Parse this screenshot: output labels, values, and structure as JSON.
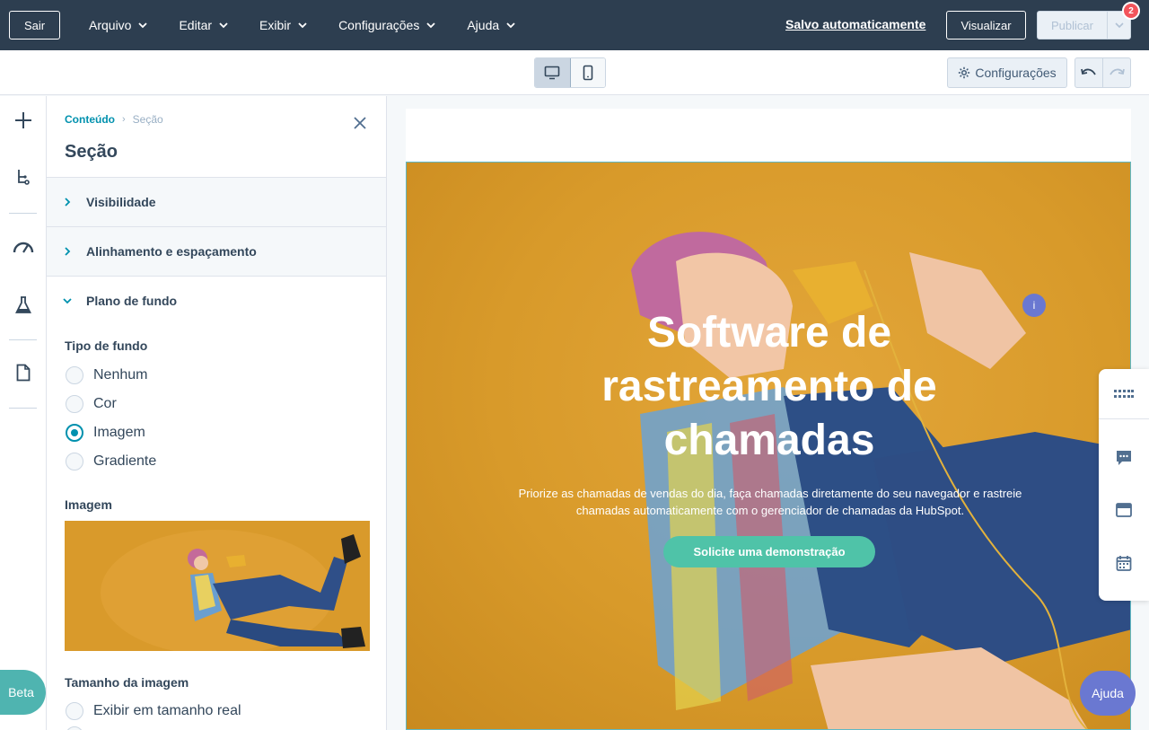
{
  "topbar": {
    "exit_label": "Sair",
    "menu": [
      {
        "label": "Arquivo"
      },
      {
        "label": "Editar"
      },
      {
        "label": "Exibir"
      },
      {
        "label": "Configurações"
      },
      {
        "label": "Ajuda"
      }
    ],
    "autosave": "Salvo automaticamente",
    "preview_label": "Visualizar",
    "publish_label": "Publicar",
    "notification_count": "2",
    "bg_color": "#2d3e50"
  },
  "subbar": {
    "settings_label": "Configurações"
  },
  "rail": {
    "beta_label": "Beta"
  },
  "panel": {
    "breadcrumb_parent": "Conteúdo",
    "breadcrumb_current": "Seção",
    "title": "Seção",
    "accordions": [
      {
        "label": "Visibilidade"
      },
      {
        "label": "Alinhamento e espaçamento"
      },
      {
        "label": "Plano de fundo"
      }
    ],
    "background_type_label": "Tipo de fundo",
    "background_options": [
      {
        "label": "Nenhum",
        "checked": false
      },
      {
        "label": "Cor",
        "checked": false
      },
      {
        "label": "Imagem",
        "checked": true
      },
      {
        "label": "Gradiente",
        "checked": false
      }
    ],
    "image_label": "Imagem",
    "image_size_label": "Tamanho da imagem",
    "image_size_options": [
      {
        "label": "Exibir em tamanho real"
      }
    ]
  },
  "hero": {
    "title": "Software de rastreamento de chamadas",
    "subtitle": "Priorize as chamadas de vendas do dia, faça chamadas diretamente do seu navegador e rastreie chamadas automaticamente com o gerenciador de chamadas da HubSpot.",
    "cta_label": "Solicite uma demonstração",
    "info_label": "i",
    "accent_color": "#4fc3a8"
  },
  "help_label": "Ajuda"
}
